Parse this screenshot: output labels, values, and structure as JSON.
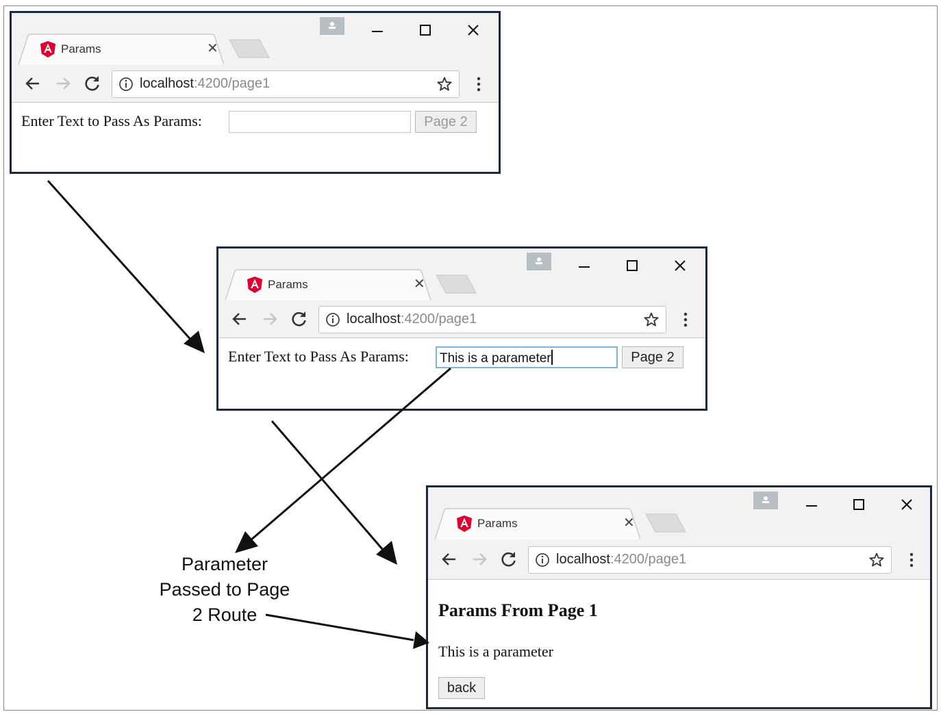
{
  "windows": [
    {
      "id": "window-1",
      "tab_title": "Params",
      "url_host": "localhost",
      "url_path": ":4200/page1",
      "form_label": "Enter Text to Pass As Params:",
      "input_value": "",
      "button_label": "Page 2",
      "button_state": "disabled"
    },
    {
      "id": "window-2",
      "tab_title": "Params",
      "url_host": "localhost",
      "url_path": ":4200/page1",
      "form_label": "Enter Text to Pass As Params:",
      "input_value": "This is a parameter",
      "button_label": "Page 2",
      "button_state": "enabled"
    },
    {
      "id": "window-3",
      "tab_title": "Params",
      "url_host": "localhost",
      "url_path": ":4200/page1",
      "heading": "Params From Page 1",
      "param_text": "This is a parameter",
      "button_label": "back"
    }
  ],
  "callout": {
    "line1": "Parameter",
    "line2": "Passed to Page",
    "line3": "2 Route"
  },
  "icons": {
    "favicon": "angular-logo-icon",
    "info": "info-circle-icon",
    "bookmark": "star-outline-icon",
    "menu": "kebab-menu-icon",
    "back": "arrow-left-icon",
    "forward": "arrow-right-icon",
    "reload": "reload-icon",
    "profile": "profile-icon",
    "minimize": "minimize-icon",
    "maximize": "maximize-icon",
    "close": "close-icon"
  },
  "colors": {
    "window_border": "#1e2a3e",
    "angular_red": "#dd0031",
    "chrome_bg": "#f2f2f2",
    "focus_border": "#7fb3d8"
  }
}
